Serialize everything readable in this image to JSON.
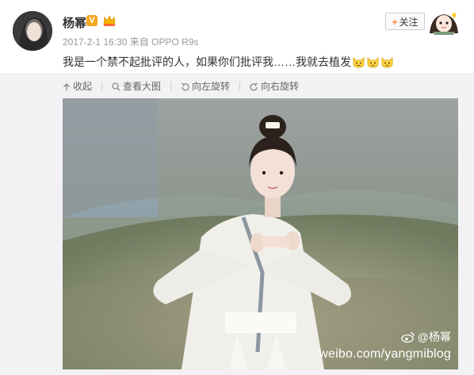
{
  "post": {
    "author": "杨幂",
    "vip_badge": "V",
    "timestamp": "2017-2-1 16:30",
    "source_prefix": "来自",
    "source": "OPPO R9s",
    "text": "我是一个禁不起批评的人，如果你们批评我……我就去植发",
    "emoticons": [
      "cat-face",
      "cat-face",
      "cat-face"
    ]
  },
  "follow": {
    "label": "关注"
  },
  "toolbar": {
    "collapse": "收起",
    "view_large": "查看大图",
    "rotate_left": "向左旋转",
    "rotate_right": "向右旋转"
  },
  "image": {
    "watermark_handle": "@杨幂",
    "watermark_url": "weibo.com/yangmiblog"
  },
  "colors": {
    "accent": "#ff8140",
    "link": "#eb7350",
    "meta": "#999999"
  }
}
